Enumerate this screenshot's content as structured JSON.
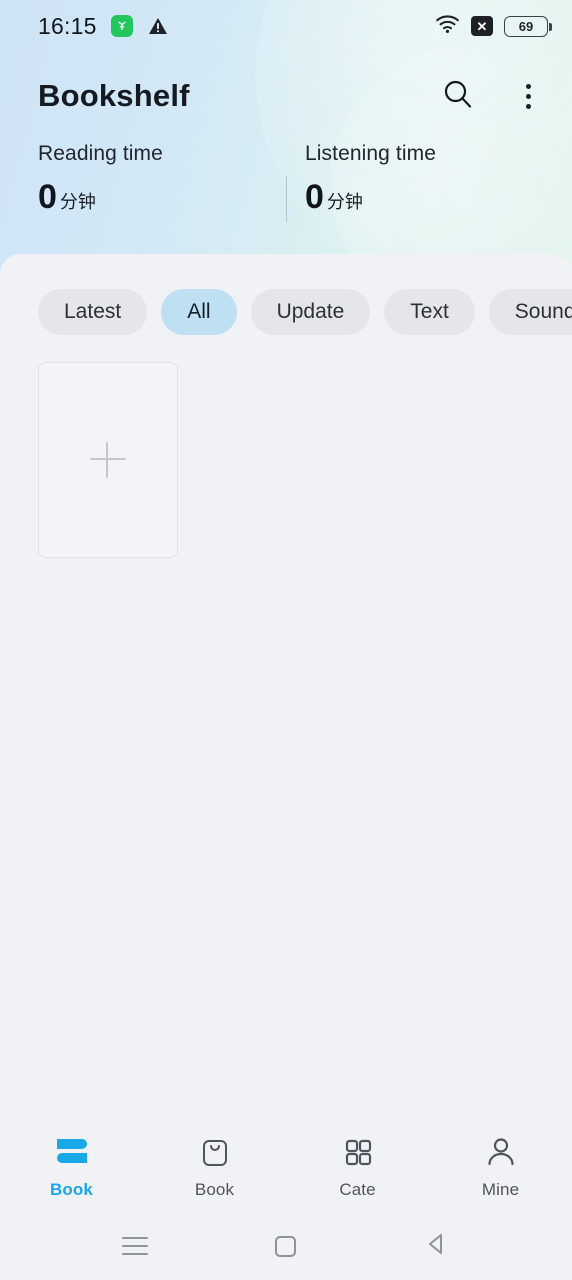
{
  "statusbar": {
    "time": "16:15",
    "icons": {
      "app_badge": "green-app-icon",
      "warning": "warning-triangle-icon",
      "wifi": "wifi-icon",
      "no_signal": "x-badge-icon",
      "battery": "battery-icon"
    },
    "battery_level": "69"
  },
  "appbar": {
    "title": "Bookshelf",
    "search_icon": "search-icon",
    "menu_icon": "more-vertical-icon"
  },
  "stats": [
    {
      "label": "Reading time",
      "value": "0",
      "unit": "分钟"
    },
    {
      "label": "Listening time",
      "value": "0",
      "unit": "分钟"
    }
  ],
  "chips": [
    {
      "label": "Latest",
      "active": false
    },
    {
      "label": "All",
      "active": true
    },
    {
      "label": "Update",
      "active": false
    },
    {
      "label": "Text",
      "active": false
    },
    {
      "label": "Sound",
      "active": false
    },
    {
      "label": "",
      "active": false
    }
  ],
  "grid": {
    "add_card_icon": "plus-icon"
  },
  "tabs": [
    {
      "label": "Book",
      "icon": "bookshelf-icon",
      "active": true
    },
    {
      "label": "Book",
      "icon": "shopping-bag-icon",
      "active": false
    },
    {
      "label": "Cate",
      "icon": "grid-icon",
      "active": false
    },
    {
      "label": "Mine",
      "icon": "person-icon",
      "active": false
    }
  ],
  "navbar": {
    "recents_icon": "recents-icon",
    "home_icon": "home-square-icon",
    "back_icon": "back-triangle-icon"
  },
  "colors": {
    "accent": "#18a8e8",
    "chip_active_bg": "#bfe0f2",
    "page_bg": "#f1f2f6",
    "header_left": "#cfe3f7",
    "header_right": "#e3f3ee"
  }
}
